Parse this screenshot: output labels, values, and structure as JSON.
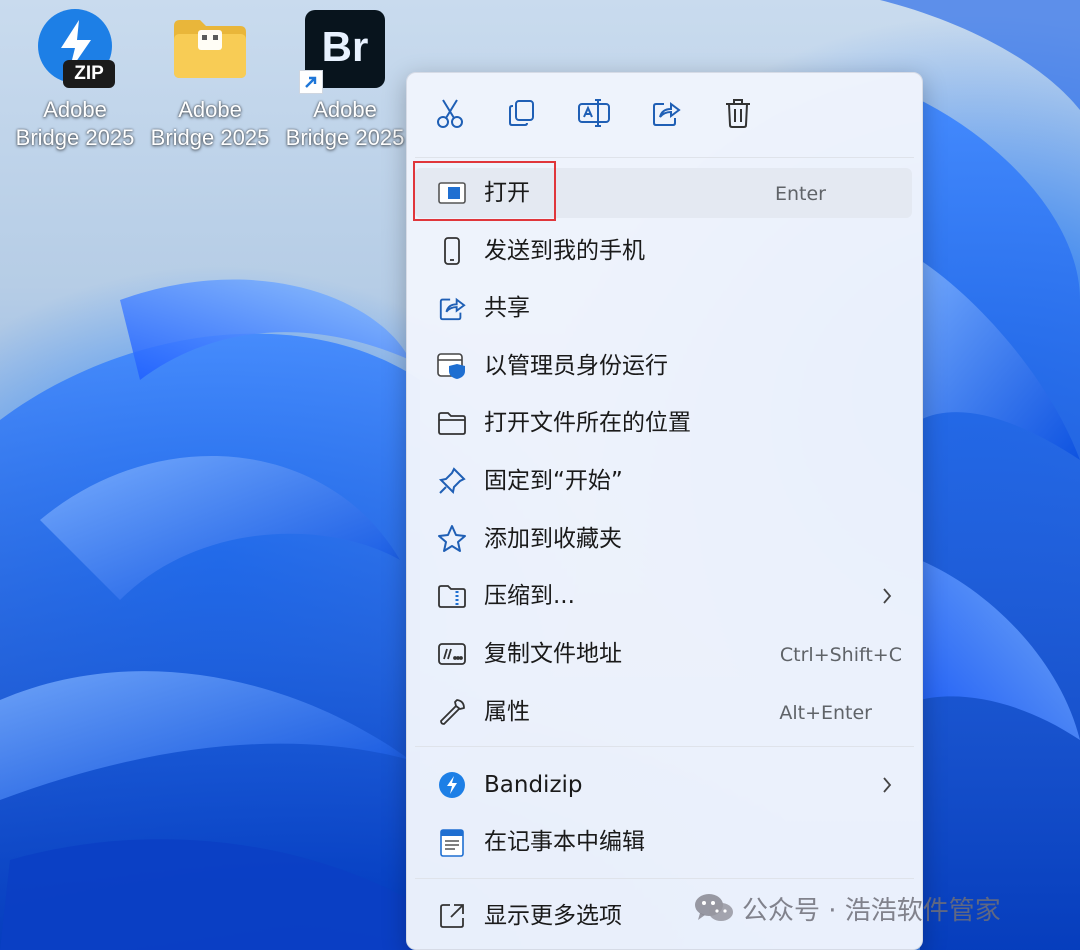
{
  "desktop": {
    "icons": [
      {
        "line1": "Adobe",
        "line2": "Bridge 2025",
        "icon": "bandizip-zip-icon",
        "badge": "ZIP"
      },
      {
        "line1": "Adobe",
        "line2": "Bridge 2025",
        "icon": "folder-icon"
      },
      {
        "line1": "Adobe",
        "line2": "Bridge 2025",
        "icon": "adobe-bridge-icon",
        "badge": "Br"
      }
    ]
  },
  "context_menu": {
    "toolbar": [
      {
        "name": "cut",
        "icon": "scissors-icon"
      },
      {
        "name": "copy",
        "icon": "copy-icon"
      },
      {
        "name": "rename",
        "icon": "rename-icon"
      },
      {
        "name": "share",
        "icon": "share-icon"
      },
      {
        "name": "delete",
        "icon": "trash-icon"
      }
    ],
    "items": [
      {
        "label": "打开",
        "shortcut": "Enter",
        "icon": "open-app-icon"
      },
      {
        "label": "发送到我的手机",
        "shortcut": "",
        "icon": "phone-icon"
      },
      {
        "label": "共享",
        "shortcut": "",
        "icon": "share-icon"
      },
      {
        "label": "以管理员身份运行",
        "shortcut": "",
        "icon": "shield-icon"
      },
      {
        "label": "打开文件所在的位置",
        "shortcut": "",
        "icon": "folder-icon"
      },
      {
        "label": "固定到“开始”",
        "shortcut": "",
        "icon": "pin-icon"
      },
      {
        "label": "添加到收藏夹",
        "shortcut": "",
        "icon": "star-icon"
      },
      {
        "label": "压缩到...",
        "shortcut": "",
        "icon": "zip-folder-icon",
        "submenu": true
      },
      {
        "label": "复制文件地址",
        "shortcut": "Ctrl+Shift+C",
        "icon": "copy-path-icon"
      },
      {
        "label": "属性",
        "shortcut": "Alt+Enter",
        "icon": "wrench-icon"
      },
      {
        "label": "Bandizip",
        "shortcut": "",
        "icon": "bandizip-icon",
        "submenu": true
      },
      {
        "label": "在记事本中编辑",
        "shortcut": "",
        "icon": "notepad-icon"
      },
      {
        "label": "显示更多选项",
        "shortcut": "",
        "icon": "more-options-icon"
      }
    ]
  },
  "watermark": {
    "text": "公众号 · 浩浩软件管家",
    "icon": "wechat-icon"
  },
  "colors": {
    "accent": "#0067c0",
    "highlight_border": "#e0363b",
    "menu_bg": "#f0f4fc"
  }
}
